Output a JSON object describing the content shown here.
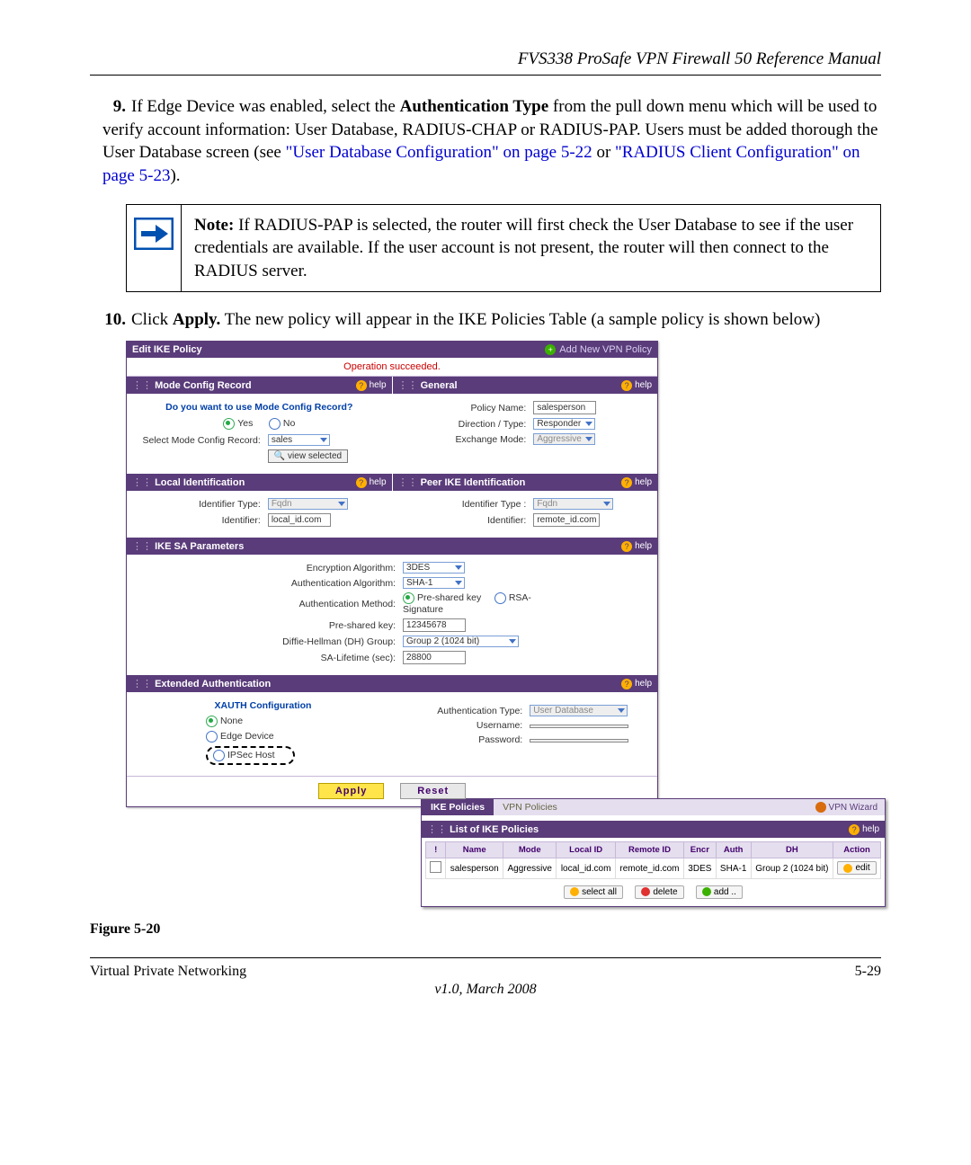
{
  "header": {
    "manual_title": "FVS338 ProSafe VPN Firewall 50 Reference Manual"
  },
  "steps": {
    "s9_num": "9.",
    "s9_a": "If Edge Device was enabled, select the ",
    "s9_b": "Authentication Type",
    "s9_c": " from the pull down menu which will be used to verify account information: User Database, RADIUS-CHAP or RADIUS-PAP. Users must be added thorough the User Database screen (see ",
    "s9_link1": "\"User Database Configuration\" on page 5-22",
    "s9_d": " or ",
    "s9_link2": "\"RADIUS Client Configuration\" on page 5-23",
    "s9_e": ").",
    "note_label": "Note:",
    "note_text": "  If RADIUS-PAP is selected, the router will first check the User Database to see if the user credentials are available. If the user account is not present, the router will then connect to the RADIUS server.",
    "s10_num": "10.",
    "s10_a": "Click ",
    "s10_b": "Apply.",
    "s10_c": " The new policy will appear in the IKE Policies Table (a sample policy is shown below)"
  },
  "ui1": {
    "edit_title": "Edit IKE Policy",
    "add_new": "Add New VPN Policy",
    "succeeded": "Operation succeeded.",
    "help": "help",
    "mode_config_sec": "Mode Config Record",
    "general_sec": "General",
    "mode_q": "Do you want to use Mode Config Record?",
    "yes": "Yes",
    "no": "No",
    "select_mc": "Select Mode Config Record:",
    "mc_value": "sales",
    "view_selected": "view selected",
    "policy_name_lbl": "Policy Name:",
    "policy_name_val": "salesperson",
    "direction_lbl": "Direction / Type:",
    "direction_val": "Responder",
    "exchange_lbl": "Exchange Mode:",
    "exchange_val": "Aggressive",
    "local_id_sec": "Local Identification",
    "peer_id_sec": "Peer IKE Identification",
    "id_type_lbl": "Identifier Type:",
    "id_type_lbl2": "Identifier Type :",
    "id_type_val": "Fqdn",
    "identifier_lbl": "Identifier:",
    "local_id_val": "local_id.com",
    "remote_id_val": "remote_id.com",
    "ike_sa_sec": "IKE SA Parameters",
    "enc_lbl": "Encryption Algorithm:",
    "enc_val": "3DES",
    "auth_lbl": "Authentication Algorithm:",
    "auth_val": "SHA-1",
    "auth_method_lbl": "Authentication Method:",
    "psk": "Pre-shared key",
    "rsa": "RSA-Signature",
    "psk_lbl": "Pre-shared key:",
    "psk_val": "12345678",
    "dh_lbl": "Diffie-Hellman (DH) Group:",
    "dh_val": "Group 2 (1024 bit)",
    "sa_life_lbl": "SA-Lifetime (sec):",
    "sa_life_val": "28800",
    "xauth_sec": "Extended Authentication",
    "xauth_cfg": "XAUTH Configuration",
    "none": "None",
    "edge": "Edge Device",
    "ipsec": "IPSec Host",
    "auth_type_lbl": "Authentication Type:",
    "auth_type_val": "User Database",
    "username_lbl": "Username:",
    "password_lbl": "Password:",
    "apply": "Apply",
    "reset": "Reset"
  },
  "ui2": {
    "tab1": "IKE Policies",
    "tab2": "VPN Policies",
    "wizard": "VPN Wizard",
    "list_title": "List of IKE Policies",
    "help": "help",
    "cols": {
      "name": "Name",
      "mode": "Mode",
      "local": "Local ID",
      "remote": "Remote ID",
      "encr": "Encr",
      "auth": "Auth",
      "dh": "DH",
      "action": "Action"
    },
    "row": {
      "name": "salesperson",
      "mode": "Aggressive",
      "local": "local_id.com",
      "remote": "remote_id.com",
      "encr": "3DES",
      "auth": "SHA-1",
      "dh": "Group 2 (1024 bit)",
      "action": "edit"
    },
    "btns": {
      "selectall": "select all",
      "delete": "delete",
      "add": "add .."
    }
  },
  "figure": "Figure 5-20",
  "footer": {
    "chapter": "Virtual Private Networking",
    "page": "5-29",
    "version": "v1.0, March 2008"
  }
}
